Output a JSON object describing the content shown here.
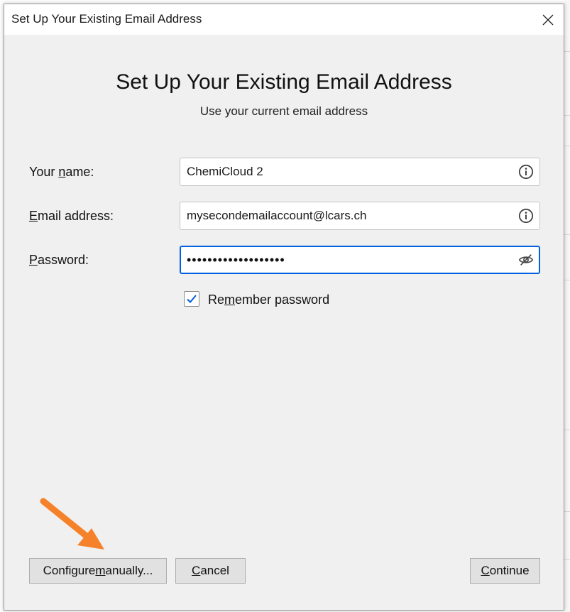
{
  "dialog": {
    "title": "Set Up Your Existing Email Address",
    "heading": "Set Up Your Existing Email Address",
    "subheading": "Use your current email address"
  },
  "form": {
    "name": {
      "label_prefix": "Your ",
      "label_key": "n",
      "label_suffix": "ame:",
      "value": "ChemiCloud 2",
      "icon": "info-icon"
    },
    "email": {
      "label_key": "E",
      "label_suffix": "mail address:",
      "value": "mysecondemailaccount@lcars.ch",
      "icon": "info-icon"
    },
    "password": {
      "label_key": "P",
      "label_suffix": "assword:",
      "masked_value": "•••••••••••••••••••",
      "icon": "eye-slash-icon"
    },
    "remember": {
      "label_prefix": "Re",
      "label_key": "m",
      "label_suffix": "ember password",
      "checked": true
    }
  },
  "buttons": {
    "configure": {
      "prefix": "Configure ",
      "key": "m",
      "suffix": "anually..."
    },
    "cancel": {
      "prefix": "",
      "key": "C",
      "suffix": "ancel"
    },
    "continue": {
      "prefix": "",
      "key": "C",
      "suffix": "ontinue"
    }
  },
  "colors": {
    "accent": "#0060df",
    "arrow": "#f5822a",
    "dialog_bg": "#f0f0f0"
  },
  "background_fragments": [
    "d",
    "u",
    "e",
    "r",
    "A",
    "i",
    "t",
    "n",
    "h",
    "H",
    "n",
    "if",
    "t"
  ]
}
